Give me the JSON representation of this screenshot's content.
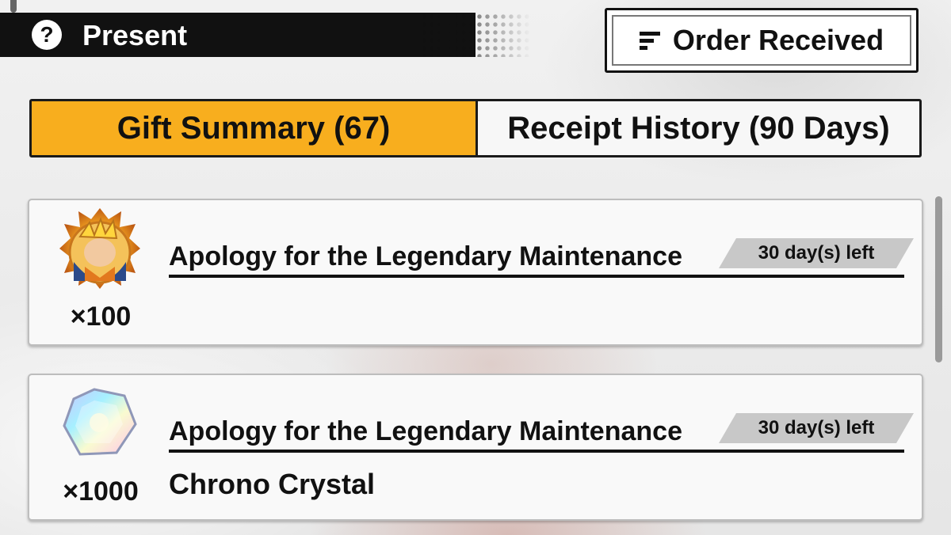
{
  "header": {
    "title": "Present",
    "help_icon": "?",
    "order_button_label": "Order Received"
  },
  "tabs": [
    {
      "label": "Gift Summary (67)",
      "active": true
    },
    {
      "label": "Receipt History (90 Days)",
      "active": false
    }
  ],
  "gifts": [
    {
      "icon": "character-medal-icon",
      "quantity": "×100",
      "title": "Apology for the Legendary Maintenance",
      "days_left": "30 day(s) left",
      "item_name": ""
    },
    {
      "icon": "chrono-crystal-icon",
      "quantity": "×1000",
      "title": "Apology for the Legendary Maintenance",
      "days_left": "30 day(s) left",
      "item_name": "Chrono Crystal"
    }
  ],
  "colors": {
    "active_tab": "#f8ae1e",
    "header_bg": "#111111",
    "badge_bg": "#c8c8c8"
  }
}
